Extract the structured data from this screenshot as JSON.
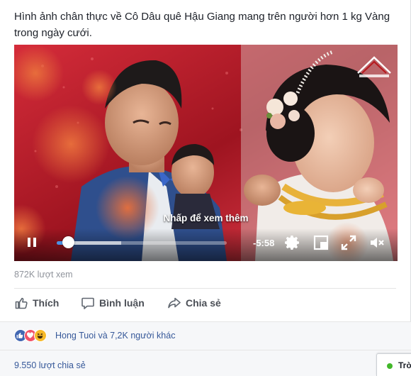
{
  "post": {
    "caption": "Hình ảnh chân thực về Cô Dâu quê Hậu Giang mang trên người hơn 1 kg Vàng trong ngày cưới."
  },
  "video": {
    "cta_text": "Nhấp để xem thêm",
    "time_remaining": "-5:58",
    "progress_fraction": 0.07,
    "buffered_fraction": 0.38,
    "controls": {
      "pause_icon": "pause-icon",
      "settings_icon": "gear-icon",
      "pip_icon": "picture-in-picture-icon",
      "fullscreen_icon": "fullscreen-icon",
      "mute_icon": "speaker-muted-icon"
    },
    "colors": {
      "progress": "#4a90e2"
    }
  },
  "stats": {
    "views": "872K lượt xem",
    "reaction_summary": "Hong Tuoi và 7,2K người khác",
    "shares": "9.550 lượt chia sẻ"
  },
  "actions": {
    "like_label": "Thích",
    "comment_label": "Bình luận",
    "share_label": "Chia sẻ"
  },
  "reactions": [
    "like",
    "love",
    "haha"
  ],
  "chat": {
    "label": "Trò"
  }
}
